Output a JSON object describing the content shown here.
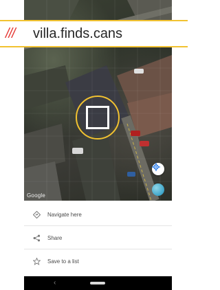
{
  "what3words": {
    "slashes": "///",
    "address": "villa.finds.cans"
  },
  "map": {
    "attribution": "Google"
  },
  "actions": [
    {
      "icon": "navigate-icon",
      "label": "Navigate here"
    },
    {
      "icon": "share-icon",
      "label": "Share"
    },
    {
      "icon": "star-icon",
      "label": "Save to a list"
    }
  ],
  "nav": {
    "back_glyph": "‹"
  },
  "colors": {
    "accent": "#f2c230",
    "slash_red": "#e53935",
    "text_dark": "#262626"
  }
}
